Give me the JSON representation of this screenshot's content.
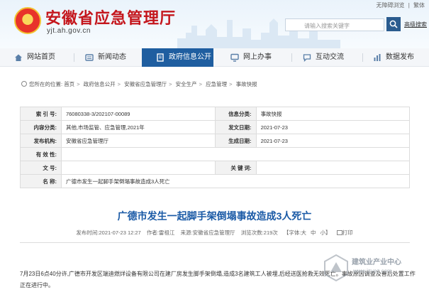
{
  "header": {
    "site_title": "安徽省应急管理厅",
    "site_url": "yjt.ah.gov.cn",
    "top_links": [
      "无障碍浏览",
      "|",
      "繁体"
    ],
    "search_placeholder": "请输入搜索关键字",
    "advanced_search": "高级搜索"
  },
  "nav": {
    "items": [
      {
        "label": "网站首页",
        "icon": "home-icon"
      },
      {
        "label": "新闻动态",
        "icon": "news-icon"
      },
      {
        "label": "政府信息公开",
        "icon": "document-icon",
        "active": true
      },
      {
        "label": "网上办事",
        "icon": "monitor-icon"
      },
      {
        "label": "互动交流",
        "icon": "chat-icon"
      },
      {
        "label": "数据发布",
        "icon": "chart-icon"
      }
    ]
  },
  "breadcrumb": {
    "prefix": "您所在的位置:",
    "items": [
      "首页",
      "政府信息公开",
      "安徽省应急管理厅",
      "安全生产",
      "应急管理",
      "事故快报"
    ]
  },
  "info_table": {
    "labels": {
      "index_no": "索 引 号:",
      "info_category": "信息分类:",
      "category": "内容分类:",
      "publish_date": "发文日期:",
      "publisher": "发布机构:",
      "created_date": "生成日期:",
      "validity": "有 效 性:",
      "doc_no": "文 号:",
      "keywords": "关 键 词:",
      "name": "名 称:"
    },
    "values": {
      "index_no": "76080338-3/202107-00089",
      "info_category": "事故快报",
      "category": "其他,市场监管、应急管理,2021年",
      "publish_date": "2021-07-23",
      "publisher": "安徽省应急管理厅",
      "created_date": "2021-07-23",
      "validity": "",
      "doc_no": "",
      "keywords": "",
      "name": "广德市发生一起脚手架倒塌事故造成3人死亡"
    }
  },
  "article": {
    "title": "广德市发生一起脚手架倒塌事故造成3人死亡",
    "meta": {
      "time_label": "发布时间:",
      "time": "2021-07-23 12:27",
      "author_label": "作者:",
      "author": "雷祖江",
      "source_label": "来源:",
      "source": "安徽省应急管理厅",
      "views_label": "浏览次数:",
      "views": "219",
      "views_unit": "次",
      "font_label": "【字体:",
      "font_large": "大",
      "font_medium": "中",
      "font_small": "小",
      "font_close": "】",
      "print": "打印"
    },
    "paragraph": "7月23日6点40分许,广德市开发区端迪燃烊设备有限公司在建厂房发生脚手架倒塌,造成3名建筑工人被埋,后经送医抢救无效死亡。事故原因调查及善后处置工作正在进行中。"
  },
  "watermark": {
    "name": "建筑业产业中心",
    "url": "www.jzyez.com"
  }
}
